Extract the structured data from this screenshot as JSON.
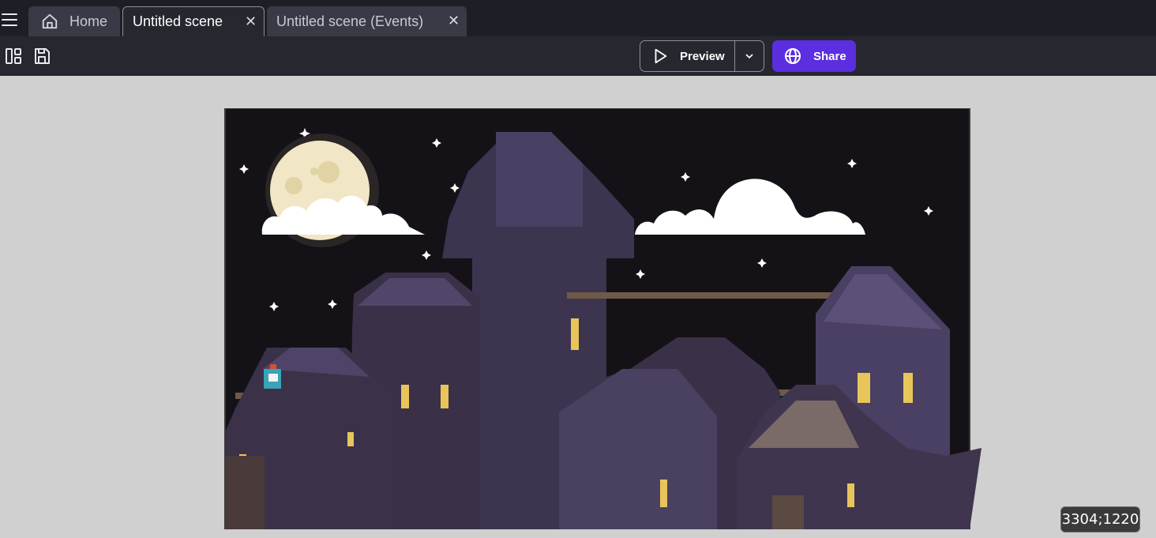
{
  "tabs": [
    {
      "label": "Home",
      "icon": "home-icon",
      "closable": false,
      "active": false
    },
    {
      "label": "Untitled scene",
      "closable": true,
      "active": true
    },
    {
      "label": "Untitled scene (Events)",
      "closable": true,
      "active": false
    }
  ],
  "toolbar": {
    "preview_label": "Preview",
    "share_label": "Share",
    "icons": [
      "layout-panels-icon",
      "save-icon",
      "play-icon",
      "chevron-down-icon",
      "globe-icon"
    ]
  },
  "canvas": {
    "cursor_coordinates": "3304;1220"
  },
  "colors": {
    "tabbar_bg": "#1e1f26",
    "toolbar_bg": "#26272f",
    "share_accent": "#5b2ee0",
    "canvas_bg": "#d0d0d0",
    "night_sky": "#141216",
    "moon": "#f1e6c5",
    "window_light": "#e8c55a"
  }
}
